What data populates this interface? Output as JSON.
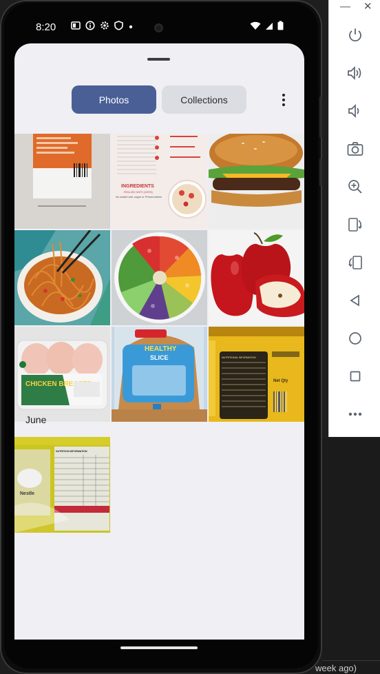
{
  "status_bar": {
    "time": "8:20",
    "icons": [
      "notification-icon",
      "info-icon",
      "settings-icon",
      "shield-icon",
      "dot-icon"
    ],
    "right_icons": [
      "wifi-icon",
      "signal-icon",
      "battery-icon"
    ]
  },
  "emulator_toolbar": {
    "buttons": [
      "power-icon",
      "volume-up-icon",
      "volume-down-icon",
      "camera-icon",
      "zoom-icon",
      "rotate-left-icon",
      "rotate-right-icon",
      "back-icon",
      "home-icon",
      "overview-icon",
      "more-icon"
    ]
  },
  "tabs": {
    "photos": "Photos",
    "collections": "Collections"
  },
  "sections": [
    {
      "label": "June"
    }
  ],
  "photos": {
    "row1": [
      "nutrition-label-orange",
      "ingredients-label",
      "cheeseburger"
    ],
    "row2": [
      "noodles",
      "rainbow-salad",
      "red-apples"
    ],
    "row3": [
      "chicken-breasts-pack",
      "healthy-slice-bread",
      "yellow-jar-label"
    ],
    "june": [
      "nestle-nutrition-label"
    ]
  },
  "photo_text": {
    "ingredients": "INGREDIENTS",
    "ingredients_sub": "ROLLED OATS (100%)",
    "ingredients_note": "No added salt, sugar or Preservatives",
    "chicken_title": "CHICKEN BREASTS",
    "bread_brand": "HEALTHY",
    "bread_sub": "SLICE",
    "jar_info": "NUTRITIONAL INFORMATION",
    "jar_net": "Net Qty",
    "nestle_brand": "Nestle",
    "nestle_info": "NUTRITION INFORMATION"
  },
  "desktop": {
    "partial_text": "week ago)"
  }
}
